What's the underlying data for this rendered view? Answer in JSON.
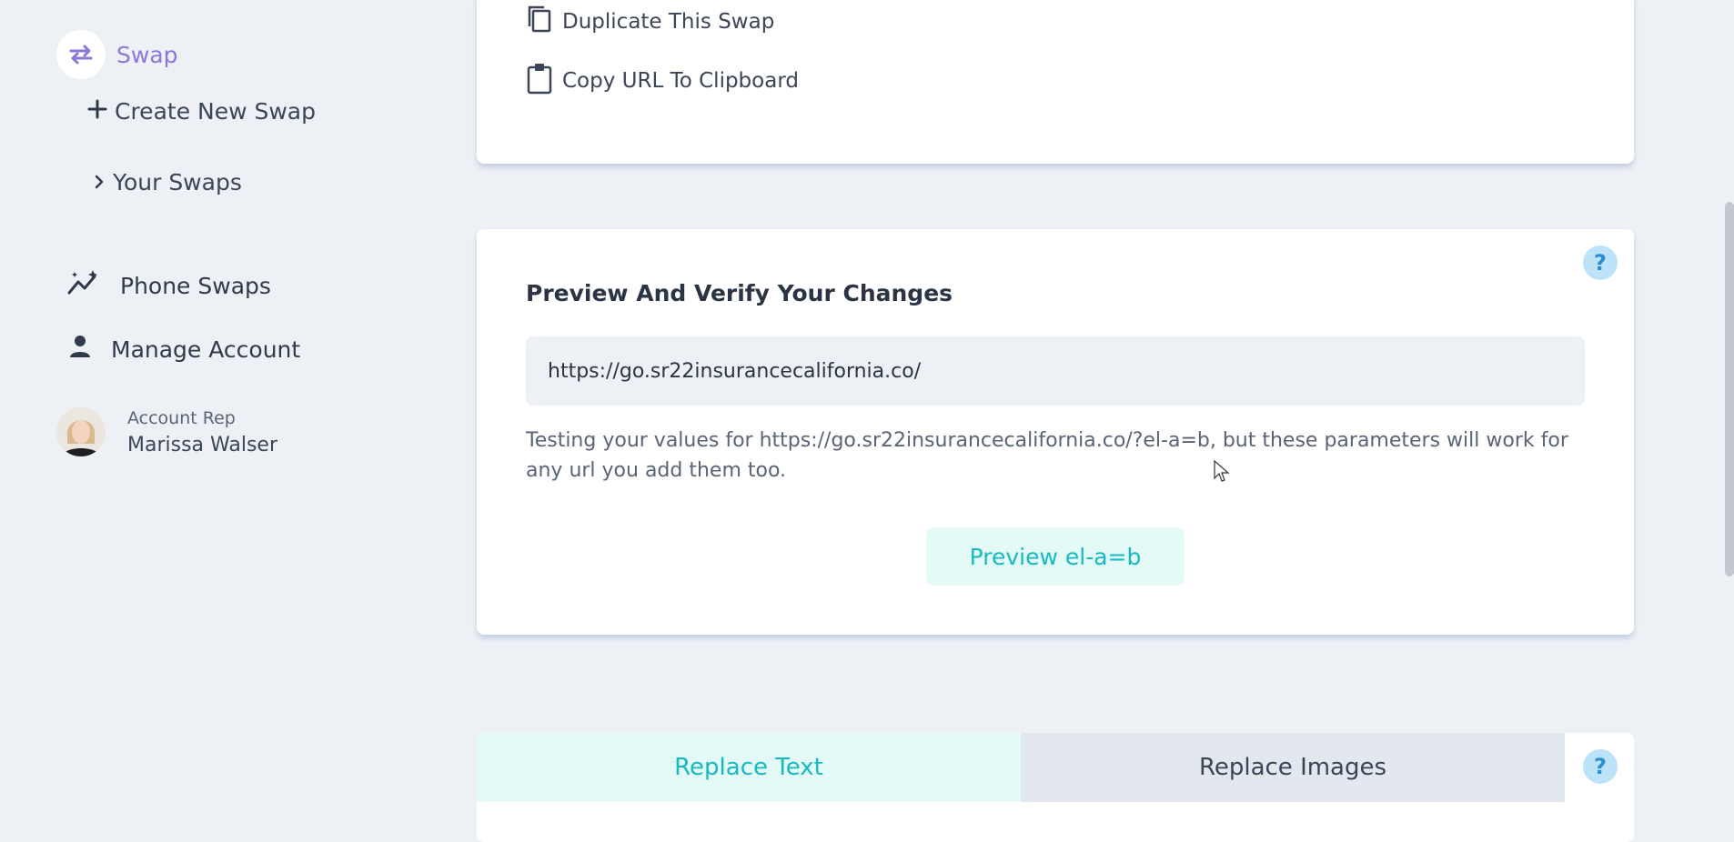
{
  "sidebar": {
    "swap_label": "Swap",
    "create_label": "Create New Swap",
    "your_swaps_label": "Your Swaps",
    "phone_swaps_label": "Phone Swaps",
    "manage_account_label": "Manage Account",
    "rep_title": "Account Rep",
    "rep_name": "Marissa Walser"
  },
  "actions": {
    "duplicate_label": "Duplicate This Swap",
    "copy_url_label": "Copy URL To Clipboard"
  },
  "preview": {
    "title": "Preview And Verify Your Changes",
    "url_value": "https://go.sr22insurancecalifornia.co/",
    "testing_text": "Testing your values for https://go.sr22insurancecalifornia.co/?el-a=b, but these parameters will work for any url you add them too.",
    "button_label": "Preview el-a=b",
    "help_label": "?"
  },
  "tabs": {
    "replace_text": "Replace Text",
    "replace_images": "Replace Images",
    "help_label": "?"
  },
  "colors": {
    "accent_purple": "#8b78d9",
    "accent_teal": "#17b9c4",
    "background": "#edf1f6"
  }
}
